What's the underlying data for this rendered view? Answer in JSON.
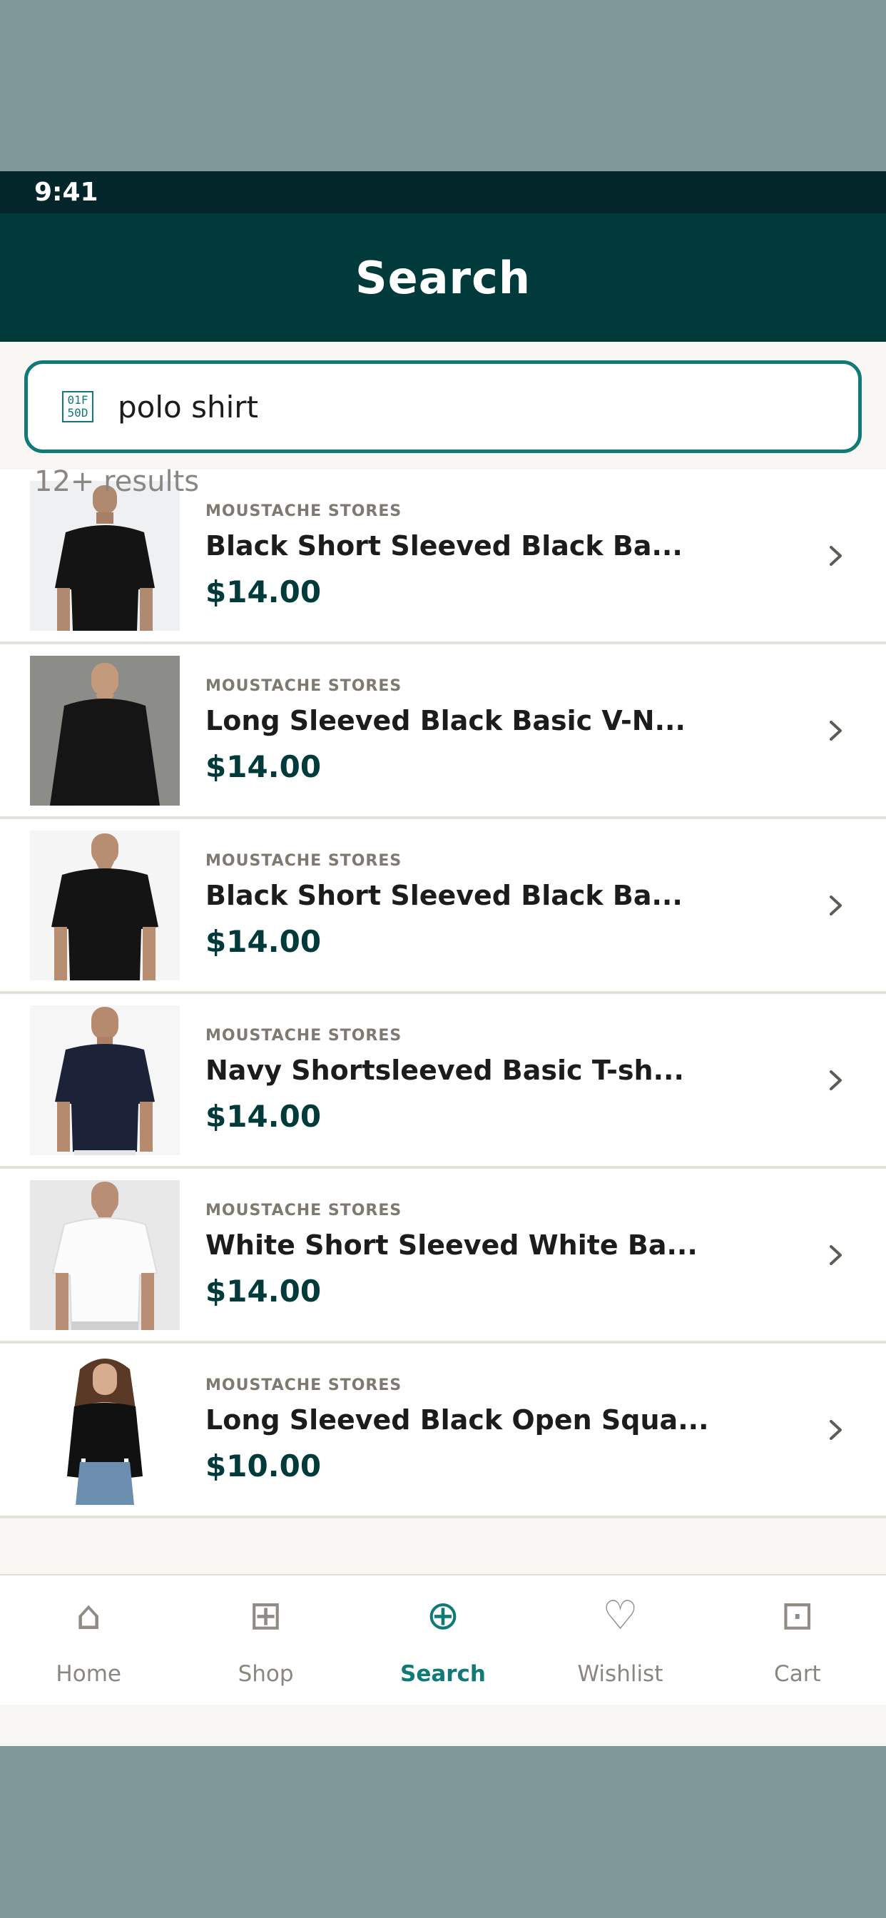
{
  "status_bar": {
    "time": "9:41"
  },
  "header": {
    "title": "Search"
  },
  "search": {
    "value": "polo shirt",
    "icon": "search-icon"
  },
  "results": {
    "count_label": "12+ results"
  },
  "products": [
    {
      "store": "MOUSTACHE STORES",
      "name": "Black Short Sleeved Black Ba...",
      "price": "$14.00"
    },
    {
      "store": "MOUSTACHE STORES",
      "name": "Long Sleeved Black Basic V-N...",
      "price": "$14.00"
    },
    {
      "store": "MOUSTACHE STORES",
      "name": "Black Short Sleeved Black Ba...",
      "price": "$14.00"
    },
    {
      "store": "MOUSTACHE STORES",
      "name": "Navy Shortsleeved Basic T-sh...",
      "price": "$14.00"
    },
    {
      "store": "MOUSTACHE STORES",
      "name": "White Short Sleeved White Ba...",
      "price": "$14.00"
    },
    {
      "store": "MOUSTACHE STORES",
      "name": "Long Sleeved Black Open Squa...",
      "price": "$10.00"
    }
  ],
  "tabs": [
    {
      "label": "Home",
      "icon": "⌂",
      "active": false
    },
    {
      "label": "Shop",
      "icon": "⊞",
      "active": false
    },
    {
      "label": "Search",
      "icon": "⊕",
      "active": true
    },
    {
      "label": "Wishlist",
      "icon": "♡",
      "active": false
    },
    {
      "label": "Cart",
      "icon": "⊡",
      "active": false
    }
  ],
  "colors": {
    "header_bg": "#003a3a",
    "status_bg": "#03262a",
    "accent": "#0f7a78",
    "price": "#003a3a",
    "outer_bg": "#7f9798"
  }
}
